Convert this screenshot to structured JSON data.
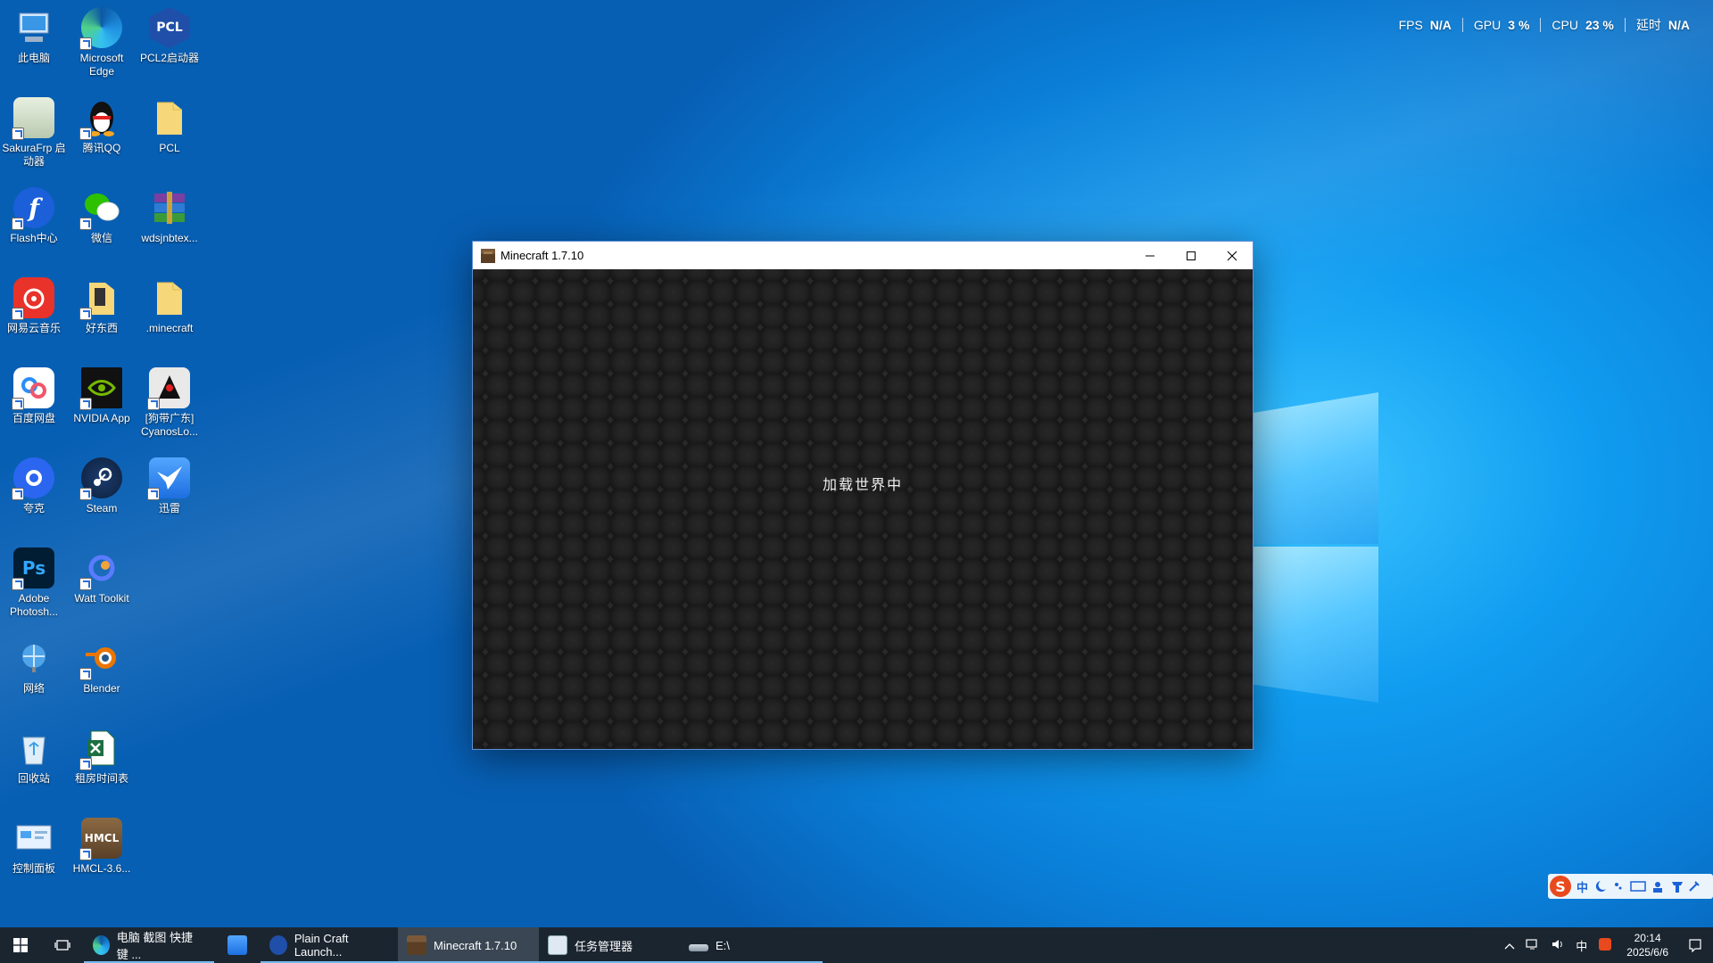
{
  "desktop": {
    "icons": [
      {
        "label": "此电脑"
      },
      {
        "label": "Microsoft Edge"
      },
      {
        "label": "PCL2启动器"
      },
      {
        "label": "SakuraFrp 启动器"
      },
      {
        "label": "腾讯QQ"
      },
      {
        "label": "PCL"
      },
      {
        "label": "Flash中心"
      },
      {
        "label": "微信"
      },
      {
        "label": "wdsjnbtex..."
      },
      {
        "label": "网易云音乐"
      },
      {
        "label": "好东西"
      },
      {
        "label": ".minecraft"
      },
      {
        "label": "百度网盘"
      },
      {
        "label": "NVIDIA App"
      },
      {
        "label": "[狗带广东] CyanosLo..."
      },
      {
        "label": "夸克"
      },
      {
        "label": "Steam"
      },
      {
        "label": "迅雷"
      },
      {
        "label": "Adobe Photosh..."
      },
      {
        "label": "Watt Toolkit"
      },
      {
        "label": "网络"
      },
      {
        "label": "Blender"
      },
      {
        "label": "回收站"
      },
      {
        "label": "租房时间表"
      },
      {
        "label": "控制面板"
      },
      {
        "label": "HMCL-3.6..."
      }
    ],
    "icon_texts": {
      "pcl": "PCL",
      "ps": "Ps",
      "hmcl": "HMCL"
    }
  },
  "stats": {
    "fps_label": "FPS",
    "fps_value": "N/A",
    "gpu_label": "GPU",
    "gpu_value": "3 %",
    "cpu_label": "CPU",
    "cpu_value": "23 %",
    "latency_label": "延时",
    "latency_value": "N/A"
  },
  "window": {
    "title": "Minecraft 1.7.10",
    "loading_message": "加载世界中"
  },
  "ime": {
    "logo": "S",
    "mode": "中"
  },
  "taskbar": {
    "buttons": [
      {
        "label": "电脑 截图 快捷 键 ..."
      },
      {
        "label": ""
      },
      {
        "label": "Plain Craft Launch..."
      },
      {
        "label": "Minecraft 1.7.10"
      },
      {
        "label": "任务管理器"
      },
      {
        "label": "E:\\"
      }
    ],
    "tray": {
      "ime_indicator": "中",
      "time": "20:14",
      "date": "2025/6/6"
    }
  },
  "colors": {
    "accent": "#0a7fd8",
    "taskbar": "#1b2530",
    "active_underline": "#76b9ed"
  }
}
